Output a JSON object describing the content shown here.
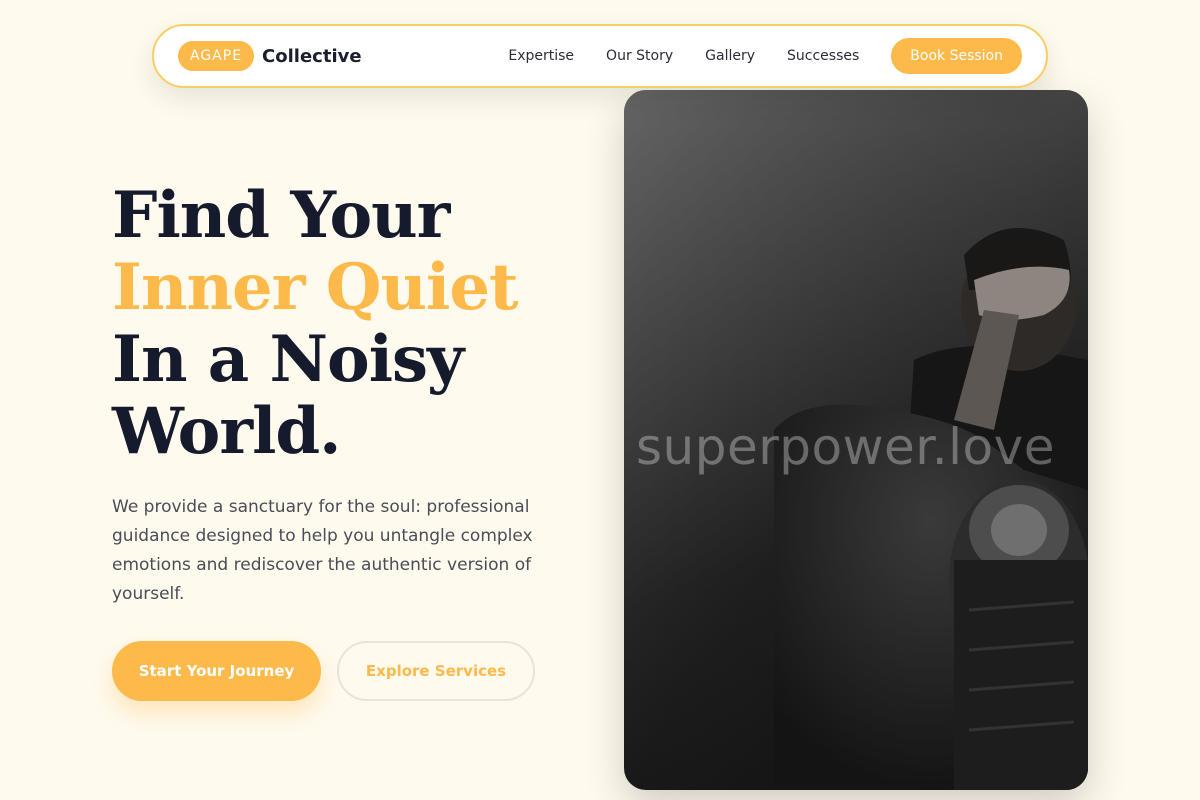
{
  "nav": {
    "logo_badge": "AGAPE",
    "logo_text": "Collective",
    "links": [
      "Expertise",
      "Our Story",
      "Gallery",
      "Successes"
    ],
    "cta": "Book Session"
  },
  "hero": {
    "headline": [
      "Find Your",
      "Inner Quiet",
      "In a Noisy",
      "World."
    ],
    "subtext": "We provide a sanctuary for the soul: professional guidance designed to help you untangle complex emotions and rediscover the authentic version of yourself.",
    "primary_button": "Start Your Journey",
    "secondary_button": "Explore Services",
    "image_watermark": "superpower.love"
  },
  "colors": {
    "accent": "#fdb94a",
    "heading": "#151a2c",
    "background": "#fefaee",
    "nav_border": "#f7cf63"
  }
}
